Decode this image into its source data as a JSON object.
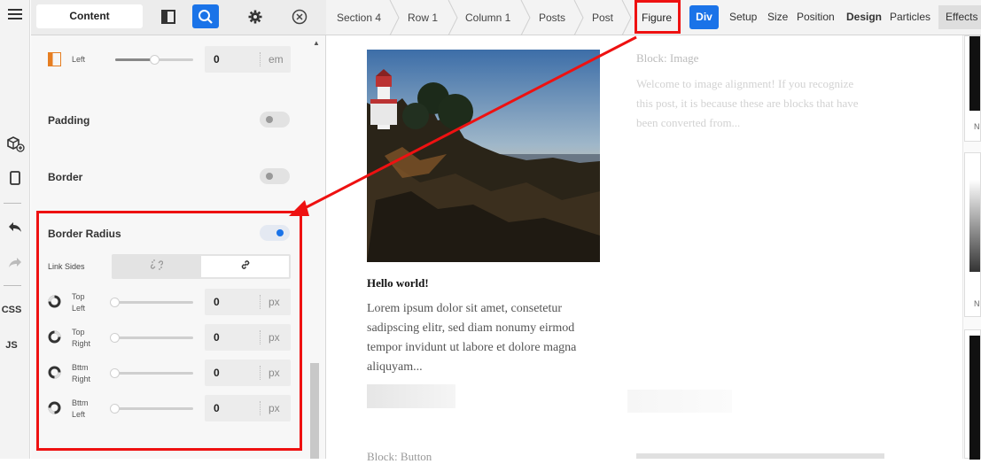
{
  "rail": {
    "css_label": "CSS",
    "js_label": "JS"
  },
  "panel": {
    "tab_content_label": "Content",
    "left_row": {
      "label": "Left",
      "value": "0",
      "unit": "em",
      "slider_level": 0.5
    },
    "padding": {
      "label": "Padding",
      "enabled": false
    },
    "border": {
      "label": "Border",
      "enabled": false
    },
    "border_radius": {
      "label": "Border Radius",
      "enabled": true,
      "link_sides_label": "Link Sides",
      "corners": [
        {
          "label_line1": "Top",
          "label_line2": "Left",
          "value": "0",
          "unit": "px",
          "icon": "corner-top-left-icon"
        },
        {
          "label_line1": "Top",
          "label_line2": "Right",
          "value": "0",
          "unit": "px",
          "icon": "corner-top-right-icon"
        },
        {
          "label_line1": "Bttm",
          "label_line2": "Right",
          "value": "0",
          "unit": "px",
          "icon": "corner-bottom-right-icon"
        },
        {
          "label_line1": "Bttm",
          "label_line2": "Left",
          "value": "0",
          "unit": "px",
          "icon": "corner-bottom-left-icon"
        }
      ]
    }
  },
  "breadcrumb": [
    "Section 4",
    "Row 1",
    "Column 1",
    "Posts",
    "Post",
    "Figure"
  ],
  "tags": {
    "div": "Div",
    "setup": "Setup",
    "size": "Size",
    "position": "Position",
    "design": "Design",
    "particles": "Particles",
    "effects": "Effects"
  },
  "canvas": {
    "post_title": "Hello world!",
    "post_text": "Lorem ipsum dolor sit amet, consetetur sadipscing elitr, sed diam nonumy eirmod tempor invidunt ut labore et dolore magna aliquyam...",
    "block_image_title": "Block: Image",
    "block_image_desc": "Welcome to image alignment! If you recognize this post, it is because these are blocks that have been converted from...",
    "block_button_title": "Block: Button"
  },
  "right_strip": {
    "n1": "N",
    "n2": "N"
  },
  "colors": {
    "accent": "#1a73e8",
    "highlight": "#e11111"
  }
}
